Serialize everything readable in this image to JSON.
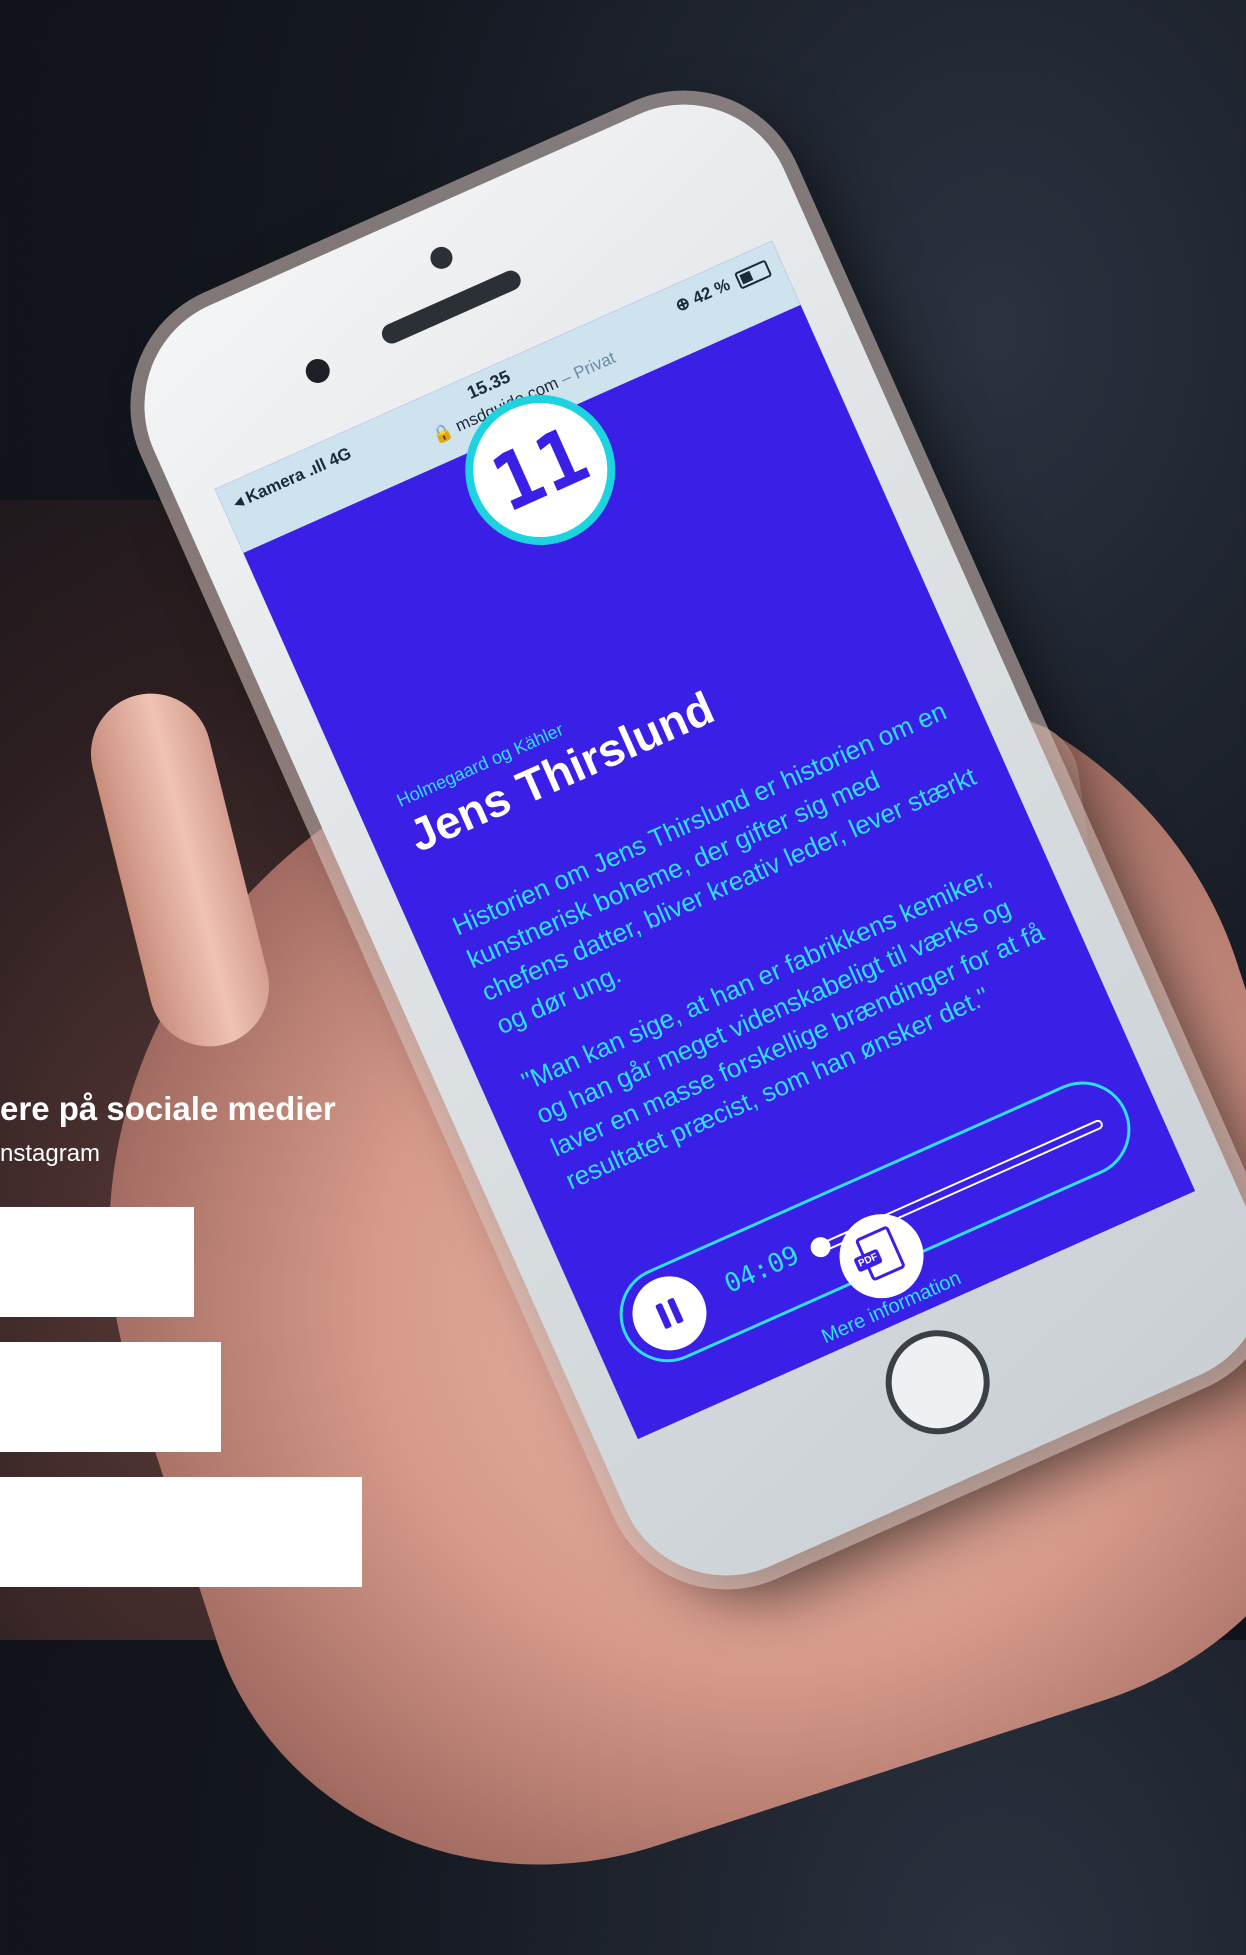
{
  "phone": {
    "status": {
      "carrier": "◂ Kamera .ıll 4G",
      "time": "15.35",
      "url": "msdguide.com",
      "private_label": "– Privat",
      "battery": "⊕ 42 %"
    },
    "badge_number": "11",
    "subtitle": "Holmegaard og Kähler",
    "title": "Jens Thirslund",
    "paragraph_1": "Historien om Jens Thirslund er historien om en kunstnerisk boheme, der gifter sig med chefens datter, bliver kreativ leder, lever stærkt og dør ung.",
    "paragraph_2": "\"Man kan sige, at han er fabrikkens kemiker, og han går meget videnskabeligt til værks og laver en masse forskellige brændinger for at få resultatet præcist, som han ønsker det.\"",
    "player": {
      "time": "04:09",
      "progress": 0.0
    },
    "pdf_label": "PDF",
    "more_info": "Mere information"
  },
  "overlay": {
    "title": "ere på sociale medier",
    "subtitle": "nstagram"
  },
  "colors": {
    "screen_bg": "#3a1fe6",
    "accent_cyan": "#30e0f0",
    "white": "#ffffff"
  }
}
